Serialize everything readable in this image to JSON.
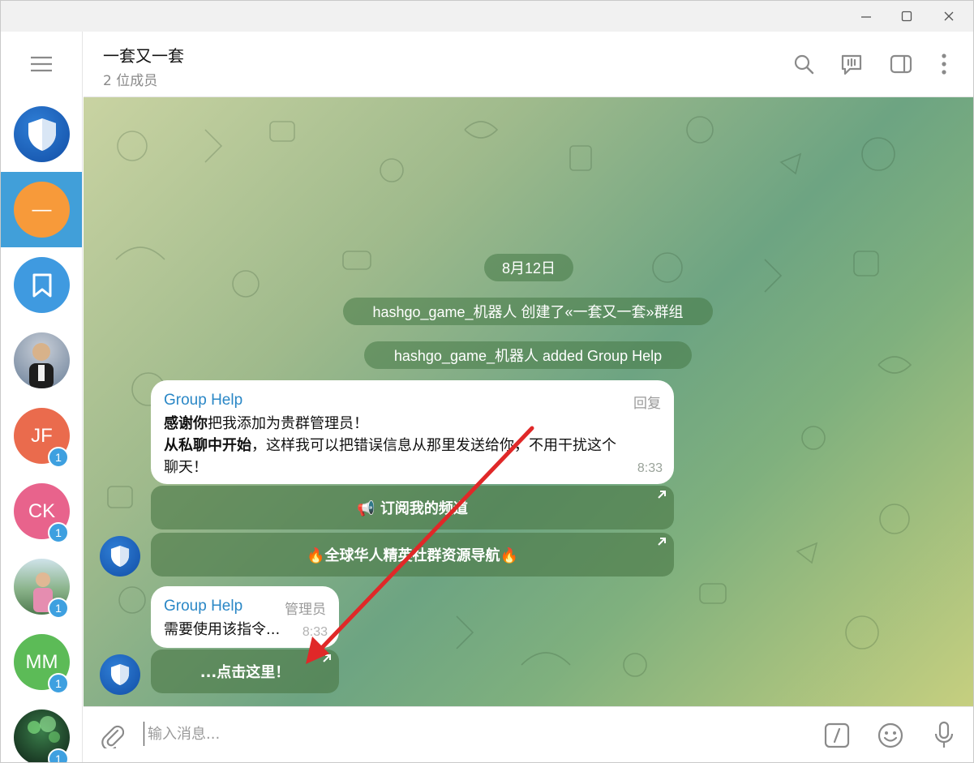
{
  "window": {
    "controls": [
      "minimize-icon",
      "maximize-icon",
      "close-icon"
    ]
  },
  "sidebar": {
    "items": [
      {
        "name": "shield",
        "initials": "",
        "badge": "",
        "color": "#1a5fb4",
        "active": false
      },
      {
        "name": "minus",
        "initials": "—",
        "badge": "",
        "color": "#f79a3a",
        "active": true
      },
      {
        "name": "saved",
        "initials": "",
        "badge": "",
        "color": "#3f9ae0",
        "active": false
      },
      {
        "name": "person-photo",
        "initials": "",
        "badge": "",
        "color": "#7a8fa8",
        "active": false
      },
      {
        "name": "jf",
        "initials": "JF",
        "badge": "1",
        "color": "#ea6b4d",
        "active": false
      },
      {
        "name": "ck",
        "initials": "CK",
        "badge": "1",
        "color": "#e8638c",
        "active": false
      },
      {
        "name": "photo-2",
        "initials": "",
        "badge": "1",
        "color": "#6c9a70",
        "active": false
      },
      {
        "name": "mm",
        "initials": "MM",
        "badge": "1",
        "color": "#5cbb57",
        "active": false
      },
      {
        "name": "photo-3",
        "initials": "",
        "badge": "1",
        "color": "#1f3a2a",
        "active": false
      }
    ]
  },
  "header": {
    "title": "一套又一套",
    "subtitle": "2 位成员"
  },
  "chat": {
    "date": "8月12日",
    "service1": "hashgo_game_机器人 创建了«一套又一套»群组",
    "service2": "hashgo_game_机器人 added Group Help",
    "msg1": {
      "sender": "Group Help",
      "tag": "回复",
      "line1_bold": "感谢你",
      "line1_rest": "把我添加为贵群管理员！",
      "line2_bold": "从私聊中开始",
      "line2_rest": "，这样我可以把错误信息从那里发送给你，不用干扰这个",
      "line3": "聊天！",
      "time": "8:33",
      "button1": "📢 订阅我的频道",
      "button2": "🔥全球华人精英社群资源导航🔥"
    },
    "msg2": {
      "sender": "Group Help",
      "tag": "管理员",
      "text": "需要使用该指令...",
      "time": "8:33",
      "button1": "...点击这里！"
    }
  },
  "composer": {
    "placeholder": "输入消息..."
  },
  "colors": {
    "accent": "#419fd9",
    "sender": "#2a87c6",
    "annotation_arrow": "#e02828"
  }
}
